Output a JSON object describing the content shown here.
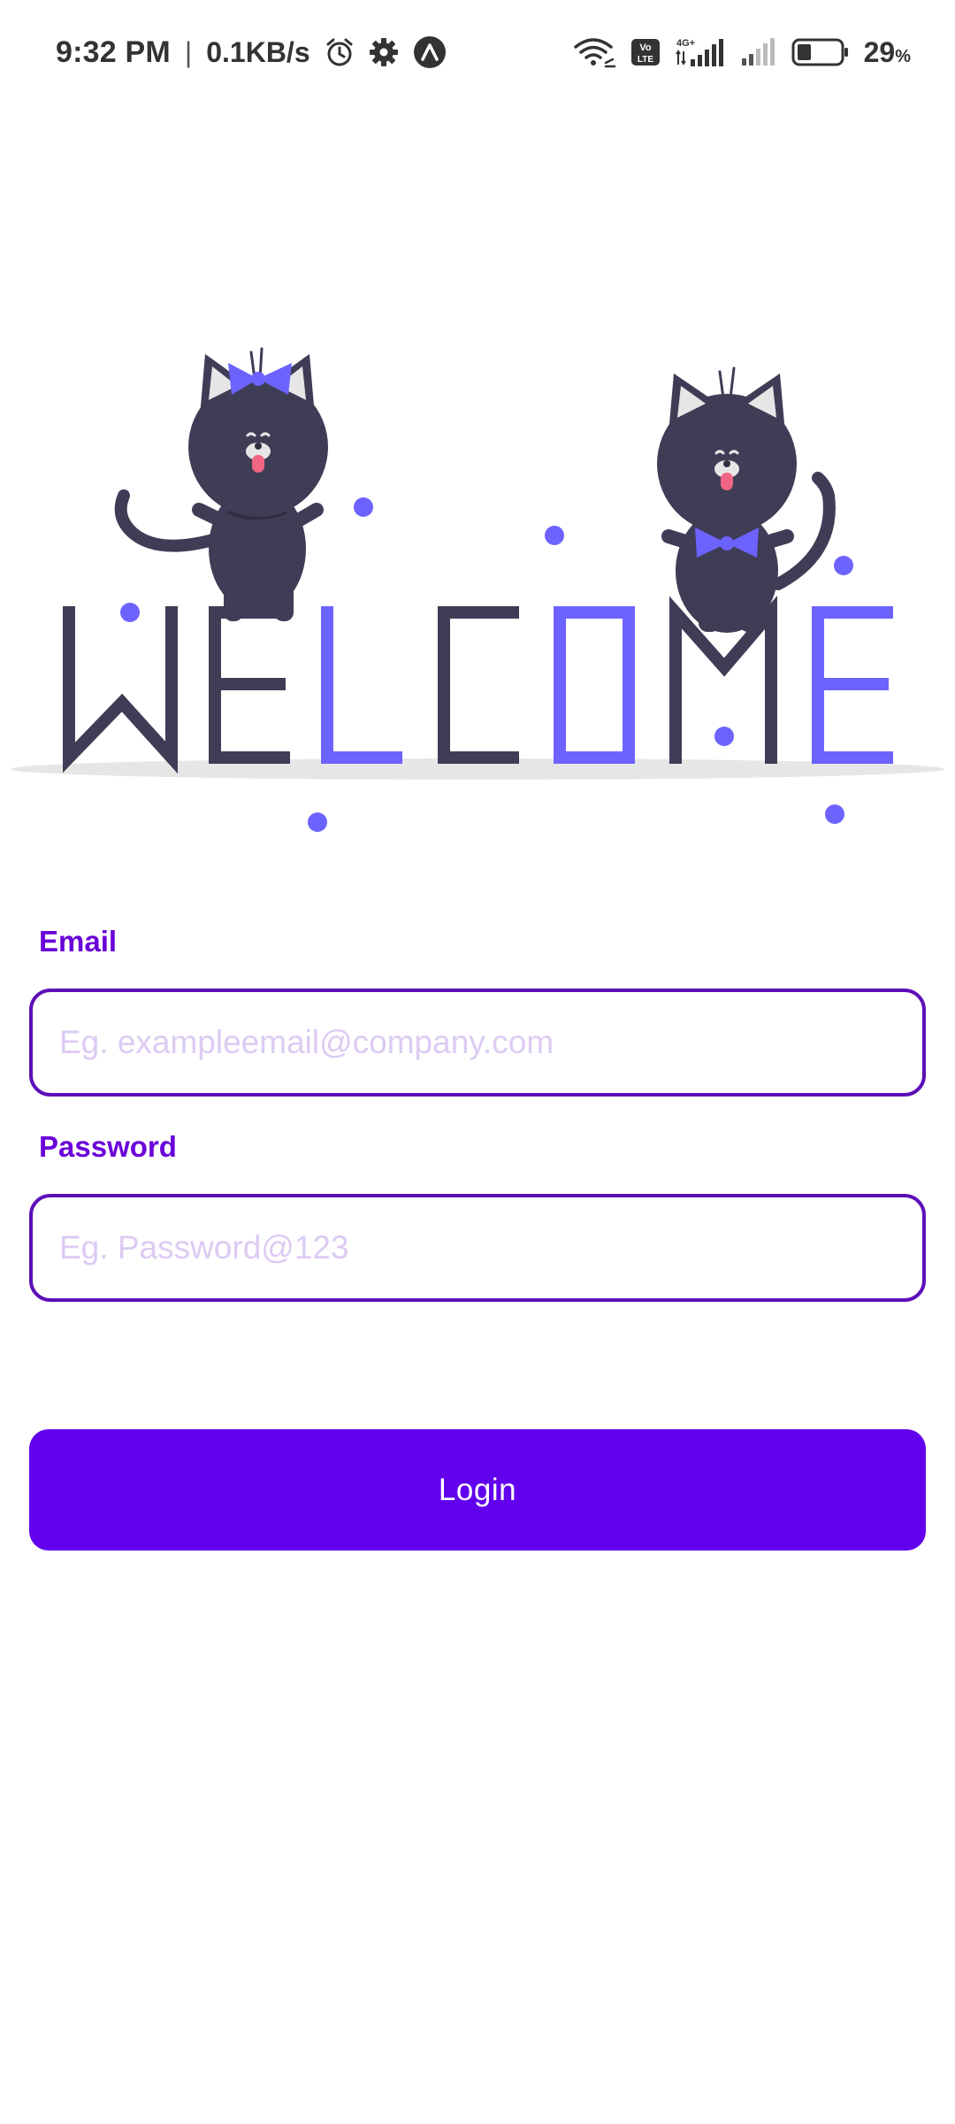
{
  "status_bar": {
    "time": "9:32 PM",
    "separator": "|",
    "net_speed": "0.1KB/s",
    "network_label": "4G+",
    "volte_label": "Vo LTE",
    "battery_percent": "29",
    "battery_unit": "%",
    "icons": [
      "alarm-icon",
      "gear-icon",
      "app-notification-icon",
      "wifi-icon",
      "volte-icon",
      "signal-icon",
      "signal-weak-icon",
      "battery-icon"
    ]
  },
  "illustration": {
    "text": "WELCOME",
    "colors": {
      "dark": "#3f3d56",
      "accent": "#6c63ff",
      "ground": "#e6e6e6",
      "tongue": "#f06583"
    }
  },
  "form": {
    "email": {
      "label": "Email",
      "placeholder": "Eg. exampleemail@company.com",
      "value": ""
    },
    "password": {
      "label": "Password",
      "placeholder": "Eg. Password@123",
      "value": ""
    }
  },
  "login_button": {
    "label": "Login"
  },
  "theme": {
    "primary": "#6200ee",
    "label_color": "#6a00d8",
    "border_color": "#5d0fb8",
    "placeholder_color": "#dccbf3"
  }
}
